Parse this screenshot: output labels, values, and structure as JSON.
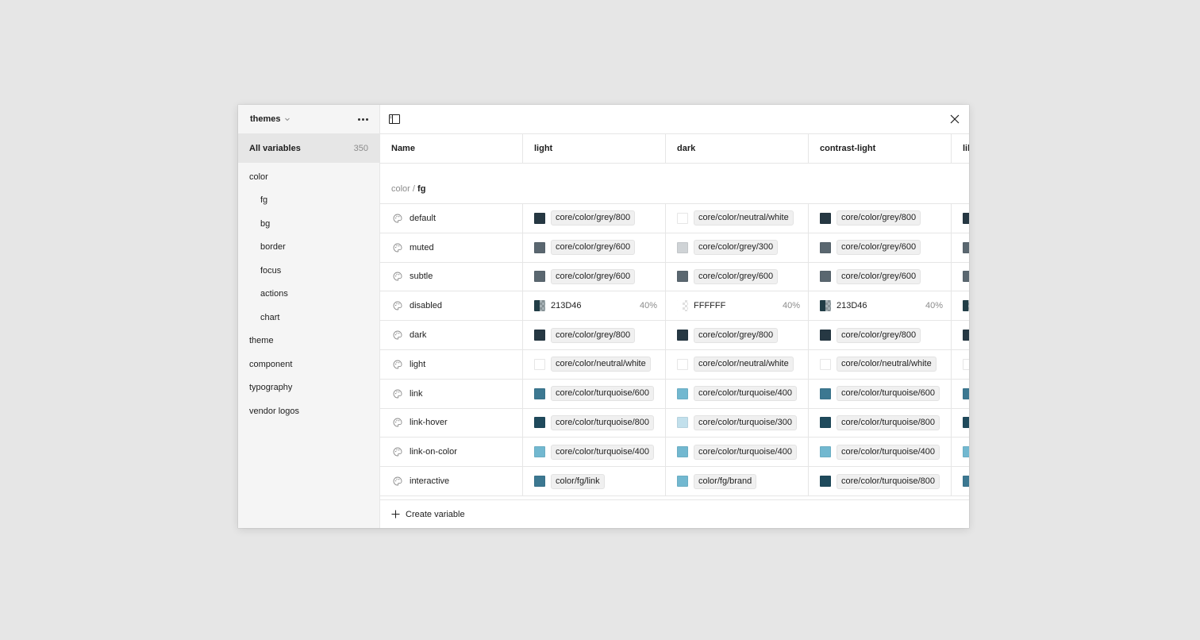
{
  "sidebar": {
    "collection": "themes",
    "all_label": "All variables",
    "all_count": "350",
    "groups": [
      {
        "label": "color",
        "child": false
      },
      {
        "label": "fg",
        "child": true
      },
      {
        "label": "bg",
        "child": true
      },
      {
        "label": "border",
        "child": true
      },
      {
        "label": "focus",
        "child": true
      },
      {
        "label": "actions",
        "child": true
      },
      {
        "label": "chart",
        "child": true
      },
      {
        "label": "theme",
        "child": false
      },
      {
        "label": "component",
        "child": false
      },
      {
        "label": "typography",
        "child": false
      },
      {
        "label": "vendor logos",
        "child": false
      }
    ]
  },
  "table": {
    "columns": [
      "Name",
      "light",
      "dark",
      "contrast-light",
      "lil"
    ],
    "group_path": "color / ",
    "group_leaf": "fg",
    "rows": [
      {
        "name": "default",
        "values": [
          {
            "swatch": "#263843",
            "alias": "core/color/grey/800"
          },
          {
            "swatch": "#ffffff",
            "alias": "core/color/neutral/white"
          },
          {
            "swatch": "#263843",
            "alias": "core/color/grey/800"
          },
          {
            "swatch": "#263843",
            "alias": ""
          }
        ]
      },
      {
        "name": "muted",
        "values": [
          {
            "swatch": "#5a6770",
            "alias": "core/color/grey/600"
          },
          {
            "swatch": "#cfd3d6",
            "alias": "core/color/grey/300"
          },
          {
            "swatch": "#5a6770",
            "alias": "core/color/grey/600"
          },
          {
            "swatch": "#5a6770",
            "alias": ""
          }
        ]
      },
      {
        "name": "subtle",
        "values": [
          {
            "swatch": "#5a6770",
            "alias": "core/color/grey/600"
          },
          {
            "swatch": "#5a6770",
            "alias": "core/color/grey/600"
          },
          {
            "swatch": "#5a6770",
            "alias": "core/color/grey/600"
          },
          {
            "swatch": "#5a6770",
            "alias": ""
          }
        ]
      },
      {
        "name": "disabled",
        "values": [
          {
            "swatch": "#213d46",
            "hex": "213D46",
            "opacity": "40%"
          },
          {
            "swatch": "#ffffff",
            "hex": "FFFFFF",
            "opacity": "40%"
          },
          {
            "swatch": "#213d46",
            "hex": "213D46",
            "opacity": "40%"
          },
          {
            "swatch": "#213d46",
            "hex": "",
            "opacity": ""
          }
        ]
      },
      {
        "name": "dark",
        "values": [
          {
            "swatch": "#263843",
            "alias": "core/color/grey/800"
          },
          {
            "swatch": "#263843",
            "alias": "core/color/grey/800"
          },
          {
            "swatch": "#263843",
            "alias": "core/color/grey/800"
          },
          {
            "swatch": "#263843",
            "alias": ""
          }
        ]
      },
      {
        "name": "light",
        "values": [
          {
            "swatch": "#ffffff",
            "alias": "core/color/neutral/white"
          },
          {
            "swatch": "#ffffff",
            "alias": "core/color/neutral/white"
          },
          {
            "swatch": "#ffffff",
            "alias": "core/color/neutral/white"
          },
          {
            "swatch": "#ffffff",
            "alias": ""
          }
        ]
      },
      {
        "name": "link",
        "values": [
          {
            "swatch": "#3c7891",
            "alias": "core/color/turquoise/600"
          },
          {
            "swatch": "#72b8d0",
            "alias": "core/color/turquoise/400"
          },
          {
            "swatch": "#3c7891",
            "alias": "core/color/turquoise/600"
          },
          {
            "swatch": "#3c7891",
            "alias": ""
          }
        ]
      },
      {
        "name": "link-hover",
        "values": [
          {
            "swatch": "#1f4a5c",
            "alias": "core/color/turquoise/800"
          },
          {
            "swatch": "#c2e0ec",
            "alias": "core/color/turquoise/300"
          },
          {
            "swatch": "#1f4a5c",
            "alias": "core/color/turquoise/800"
          },
          {
            "swatch": "#1f4a5c",
            "alias": ""
          }
        ]
      },
      {
        "name": "link-on-color",
        "values": [
          {
            "swatch": "#72b8d0",
            "alias": "core/color/turquoise/400"
          },
          {
            "swatch": "#72b8d0",
            "alias": "core/color/turquoise/400"
          },
          {
            "swatch": "#72b8d0",
            "alias": "core/color/turquoise/400"
          },
          {
            "swatch": "#72b8d0",
            "alias": ""
          }
        ]
      },
      {
        "name": "interactive",
        "values": [
          {
            "swatch": "#3c7891",
            "alias": "color/fg/link"
          },
          {
            "swatch": "#72b8d0",
            "alias": "color/fg/brand"
          },
          {
            "swatch": "#1f4a5c",
            "alias": "core/color/turquoise/800"
          },
          {
            "swatch": "#3c7891",
            "alias": ""
          }
        ]
      }
    ]
  },
  "footer": {
    "create_label": "Create variable"
  },
  "icons": {
    "sidebar_toggle": "sidebar-toggle-icon",
    "close": "close-icon",
    "variable": "color-palette-icon",
    "plus": "plus-icon",
    "more": "more-icon",
    "chevron": "chevron-down-icon"
  }
}
